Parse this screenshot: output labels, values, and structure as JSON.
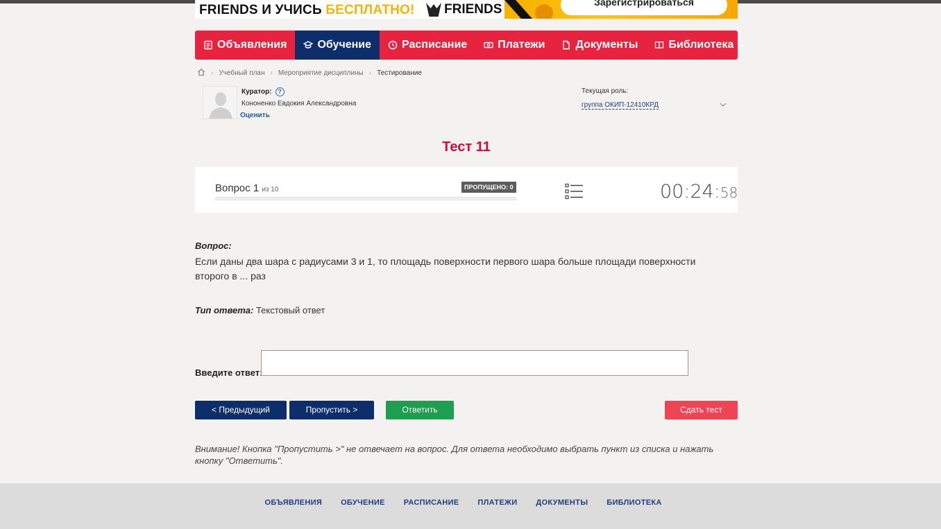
{
  "banner": {
    "text_main": "FRIENDS И УЧИСЬ ",
    "text_accent": "БЕСПЛАТНО!",
    "logo": "FRIENDS",
    "button": "Зарегистрироваться"
  },
  "nav": {
    "items": [
      {
        "label": "Объявления",
        "icon": "newspaper-icon"
      },
      {
        "label": "Обучение",
        "icon": "graduation-cap-icon"
      },
      {
        "label": "Расписание",
        "icon": "clock-icon"
      },
      {
        "label": "Платежи",
        "icon": "money-icon"
      },
      {
        "label": "Документы",
        "icon": "document-icon"
      },
      {
        "label": "Библиотека",
        "icon": "book-icon"
      }
    ],
    "active_index": 1,
    "colors": {
      "bar": "#e8233f",
      "active": "#0d2e6b"
    }
  },
  "breadcrumb": {
    "home_icon": "home-icon",
    "items": [
      "Учебный план",
      "Мероприятие дисциплины",
      "Тестирование"
    ]
  },
  "curator": {
    "label": "Куратор:",
    "name": "Кононенко Евдокия Александровна",
    "rate": "Оценить"
  },
  "role": {
    "label": "Текущая роль:",
    "value": "группа ОКИП-12410КРД"
  },
  "test": {
    "title": "Тест 11",
    "question_word": "Вопрос 1",
    "question_of": "из 10",
    "skipped": "ПРОПУЩЕНО: 0",
    "timer_main": "00:24:",
    "timer_sec": "58",
    "progress": 0
  },
  "question": {
    "label": "Вопрос:",
    "text": "Если даны два шара с радиусами 3 и 1, то площадь поверхности первого шара больше площади поверхности второго в ... раз",
    "type_label": "Тип ответа:",
    "type_value": " Текстовый ответ",
    "answer_label": "Введите ответ:",
    "answer_value": ""
  },
  "buttons": {
    "prev": "< Предыдущий",
    "skip": "Пропустить >",
    "answer": "Ответить",
    "submit": "Сдать тест"
  },
  "warning": "Внимание! Кнопка \"Пропустить >\" не отвечает на вопрос. Для ответа необходимо выбрать пункт из списка и нажать кнопку \"Ответить\".",
  "footer": {
    "links": [
      "ОБЪЯВЛЕНИЯ",
      "ОБУЧЕНИЕ",
      "РАСПИСАНИЕ",
      "ПЛАТЕЖИ",
      "ДОКУМЕНТЫ",
      "БИБЛИОТЕКА"
    ]
  }
}
